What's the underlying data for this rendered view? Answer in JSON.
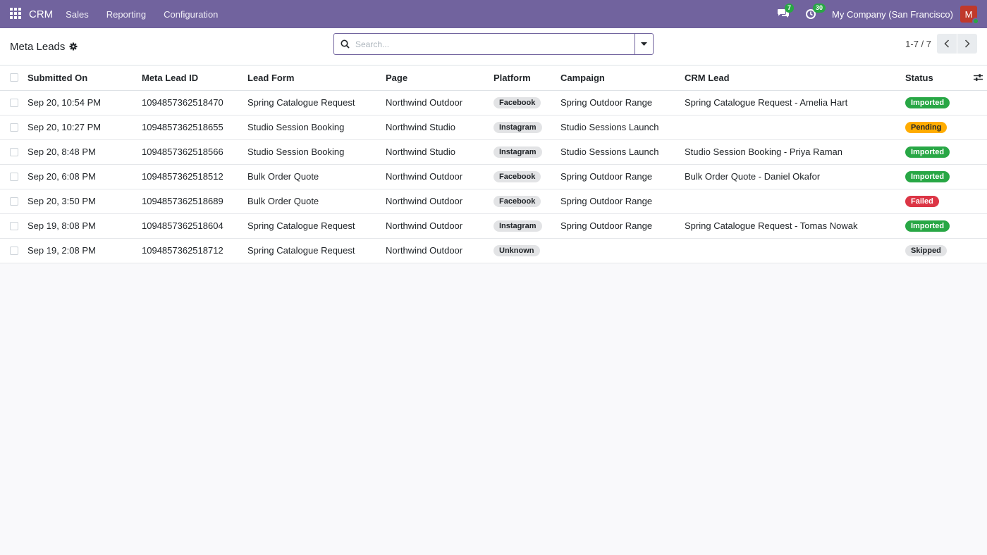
{
  "navbar": {
    "brand": "CRM",
    "menu": [
      "Sales",
      "Reporting",
      "Configuration"
    ],
    "messages_count": "7",
    "activities_count": "30",
    "company": "My Company (San Francisco)",
    "avatar_initial": "M"
  },
  "control_panel": {
    "title": "Meta Leads",
    "search_placeholder": "Search...",
    "pager": "1-7 / 7"
  },
  "table": {
    "columns": [
      "Submitted On",
      "Meta Lead ID",
      "Lead Form",
      "Page",
      "Platform",
      "Campaign",
      "CRM Lead",
      "Status"
    ],
    "rows": [
      {
        "submitted_on": "Sep 20, 10:54 PM",
        "meta_lead_id": "1094857362518470",
        "lead_form": "Spring Catalogue Request",
        "page": "Northwind Outdoor",
        "platform": "Facebook",
        "campaign": "Spring Outdoor Range",
        "crm_lead": "Spring Catalogue Request - Amelia Hart",
        "status": "Imported",
        "status_kind": "success"
      },
      {
        "submitted_on": "Sep 20, 10:27 PM",
        "meta_lead_id": "1094857362518655",
        "lead_form": "Studio Session Booking",
        "page": "Northwind Studio",
        "platform": "Instagram",
        "campaign": "Studio Sessions Launch",
        "crm_lead": "",
        "status": "Pending",
        "status_kind": "warning"
      },
      {
        "submitted_on": "Sep 20, 8:48 PM",
        "meta_lead_id": "1094857362518566",
        "lead_form": "Studio Session Booking",
        "page": "Northwind Studio",
        "platform": "Instagram",
        "campaign": "Studio Sessions Launch",
        "crm_lead": "Studio Session Booking - Priya Raman",
        "status": "Imported",
        "status_kind": "success"
      },
      {
        "submitted_on": "Sep 20, 6:08 PM",
        "meta_lead_id": "1094857362518512",
        "lead_form": "Bulk Order Quote",
        "page": "Northwind Outdoor",
        "platform": "Facebook",
        "campaign": "Spring Outdoor Range",
        "crm_lead": "Bulk Order Quote - Daniel Okafor",
        "status": "Imported",
        "status_kind": "success"
      },
      {
        "submitted_on": "Sep 20, 3:50 PM",
        "meta_lead_id": "1094857362518689",
        "lead_form": "Bulk Order Quote",
        "page": "Northwind Outdoor",
        "platform": "Facebook",
        "campaign": "Spring Outdoor Range",
        "crm_lead": "",
        "status": "Failed",
        "status_kind": "danger"
      },
      {
        "submitted_on": "Sep 19, 8:08 PM",
        "meta_lead_id": "1094857362518604",
        "lead_form": "Spring Catalogue Request",
        "page": "Northwind Outdoor",
        "platform": "Instagram",
        "campaign": "Spring Outdoor Range",
        "crm_lead": "Spring Catalogue Request - Tomas Nowak",
        "status": "Imported",
        "status_kind": "success"
      },
      {
        "submitted_on": "Sep 19, 2:08 PM",
        "meta_lead_id": "1094857362518712",
        "lead_form": "Spring Catalogue Request",
        "page": "Northwind Outdoor",
        "platform": "Unknown",
        "campaign": "",
        "crm_lead": "",
        "status": "Skipped",
        "status_kind": "muted"
      }
    ]
  },
  "colors": {
    "navbar_bg": "#71639e",
    "success": "#28a745",
    "warning": "#ffac00",
    "danger": "#dc3545",
    "muted": "#e2e3e5"
  }
}
